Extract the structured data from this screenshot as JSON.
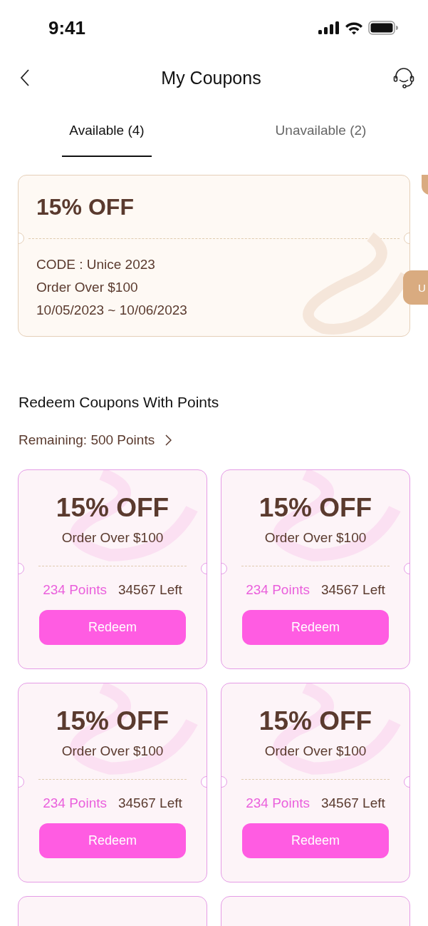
{
  "status_bar": {
    "time": "9:41"
  },
  "header": {
    "title": "My Coupons"
  },
  "tabs": [
    {
      "label": "Available (4)",
      "selected": true
    },
    {
      "label": "Unavailable (2)",
      "selected": false
    }
  ],
  "coupon": {
    "discount": "15% OFF",
    "code": "CODE : Unice 2023",
    "condition": "Order Over $100",
    "validity": "10/05/2023 ~ 10/06/2023"
  },
  "next_coupon": {
    "button": "U"
  },
  "redeem": {
    "title": "Redeem Coupons With Points",
    "remaining": "Remaining: 500 Points",
    "coupons": [
      {
        "kind": "full",
        "discount": "15% OFF",
        "condition": "Order Over $100",
        "points": "234 Points",
        "left": "34567 Left",
        "button": "Redeem"
      },
      {
        "kind": "full",
        "discount": "15% OFF",
        "condition": "Order Over $100",
        "points": "234 Points",
        "left": "34567 Left",
        "button": "Redeem"
      },
      {
        "kind": "full",
        "discount": "15% OFF",
        "condition": "Order Over $100",
        "points": "234 Points",
        "left": "34567 Left",
        "button": "Redeem"
      },
      {
        "kind": "full",
        "discount": "15% OFF",
        "condition": "Order Over $100",
        "points": "234 Points",
        "left": "34567 Left",
        "button": "Redeem"
      },
      {
        "kind": "cut"
      },
      {
        "kind": "cut"
      }
    ]
  }
}
